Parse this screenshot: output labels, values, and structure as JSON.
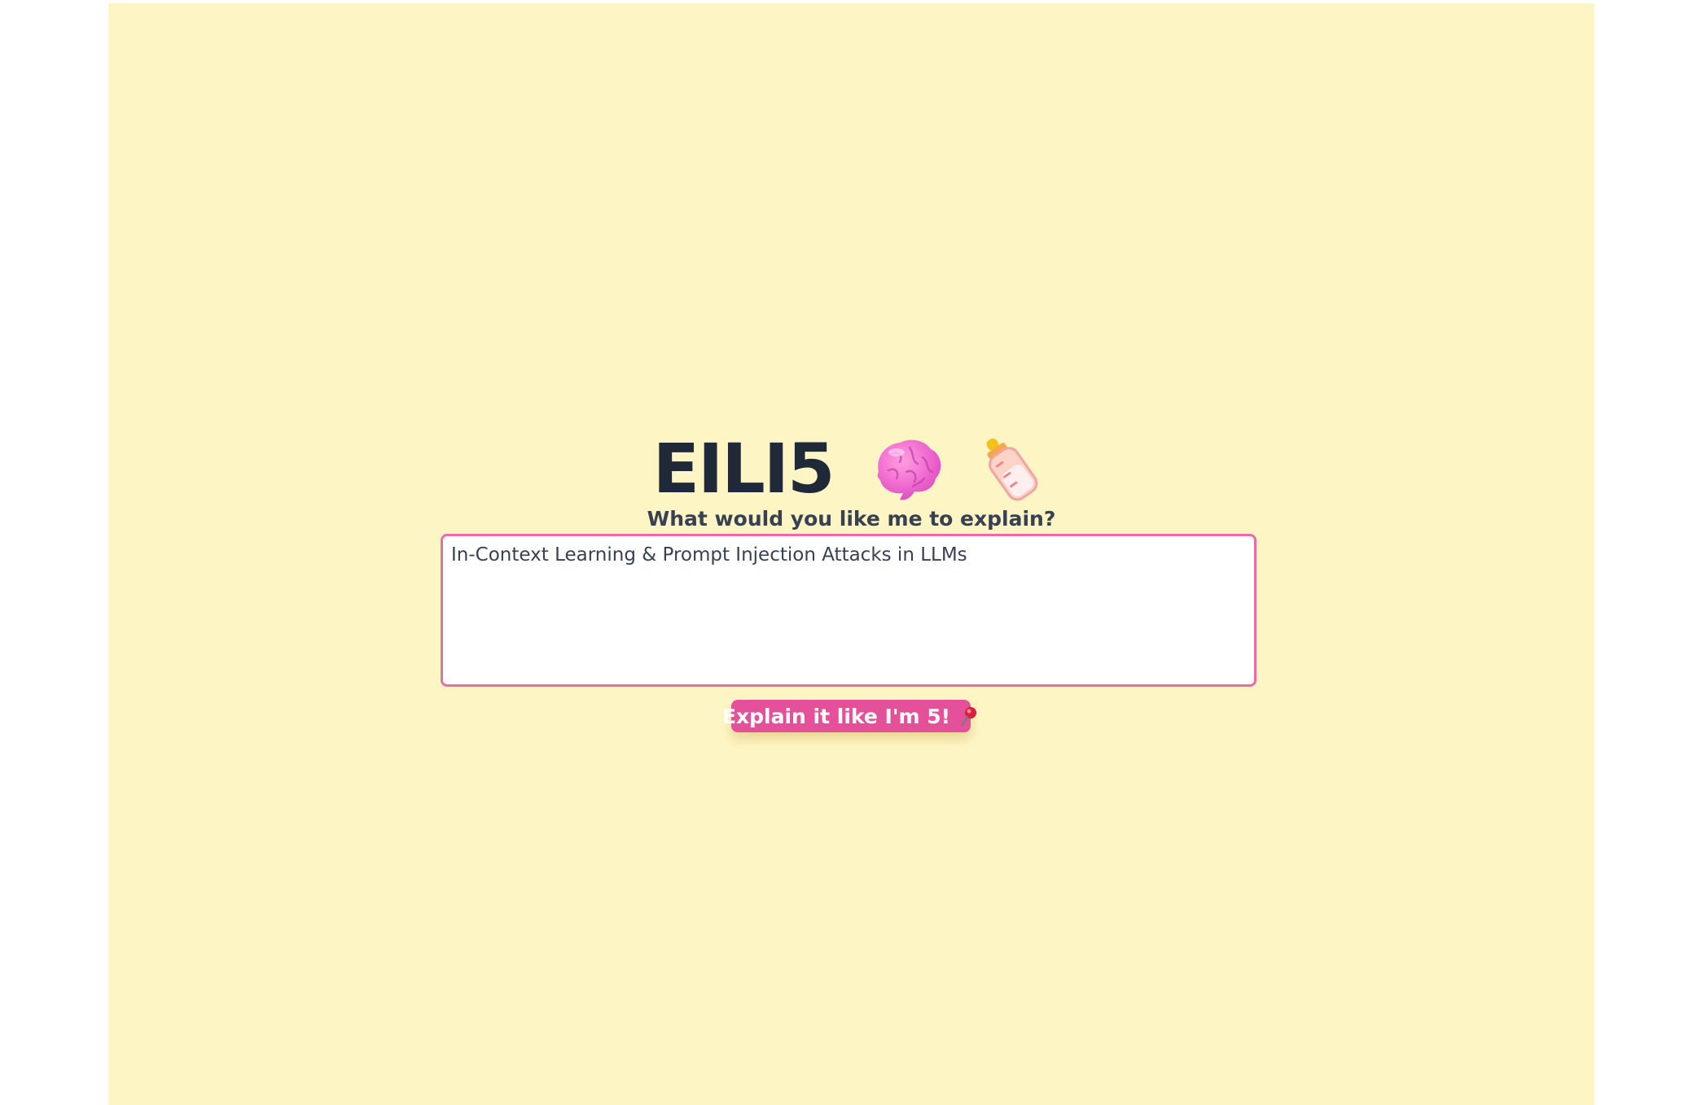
{
  "app": {
    "title": "EILI5",
    "title_icons": [
      "brain-icon",
      "baby-bottle-icon"
    ],
    "subtitle": "What would you like me to explain?"
  },
  "prompt": {
    "value": "In-Context Learning & Prompt Injection Attacks in LLMs"
  },
  "submit": {
    "label": "Explain it like I'm 5!",
    "icon": "pushpin-icon"
  },
  "colors": {
    "background": "#fdf6c4",
    "accent": "#e4509a",
    "border": "#ec6aa8",
    "text_dark": "#1f2937"
  }
}
